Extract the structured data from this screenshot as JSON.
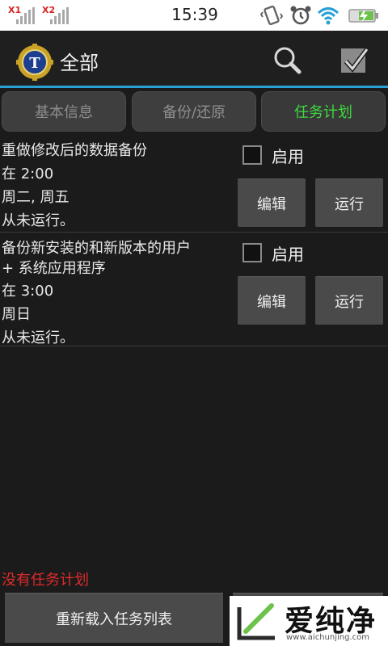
{
  "status_bar": {
    "sim1_label": "X1",
    "sim2_label": "X2",
    "time": "15:39"
  },
  "action_bar": {
    "title": "全部",
    "icons": [
      "titanium-backup-app-icon",
      "search-icon",
      "batch-checkmark-icon"
    ]
  },
  "tabs": [
    {
      "label": "基本信息",
      "active": false
    },
    {
      "label": "备份/还原",
      "active": false
    },
    {
      "label": "任务计划",
      "active": true
    }
  ],
  "schedules": [
    {
      "lines": [
        "重做修改后的数据备份",
        "在 2:00",
        "周二, 周五",
        "从未运行。"
      ],
      "enable_label": "启用",
      "enabled": false,
      "edit_label": "编辑",
      "run_label": "运行"
    },
    {
      "lines": [
        "备份新安装的和新版本的用户",
        "+ 系统应用程序",
        "在 3:00",
        "周日",
        "从未运行。"
      ],
      "enable_label": "启用",
      "enabled": false,
      "edit_label": "编辑",
      "run_label": "运行"
    }
  ],
  "footer": {
    "empty_message": "没有任务计划",
    "reload_label": "重新载入任务列表"
  },
  "watermark": {
    "text": "爱纯净",
    "url": "www.aichunjing.com"
  },
  "colors": {
    "accent": "#2aa0d5",
    "active_tab_text": "#3ddb3d",
    "error_text": "#e02a2a"
  }
}
